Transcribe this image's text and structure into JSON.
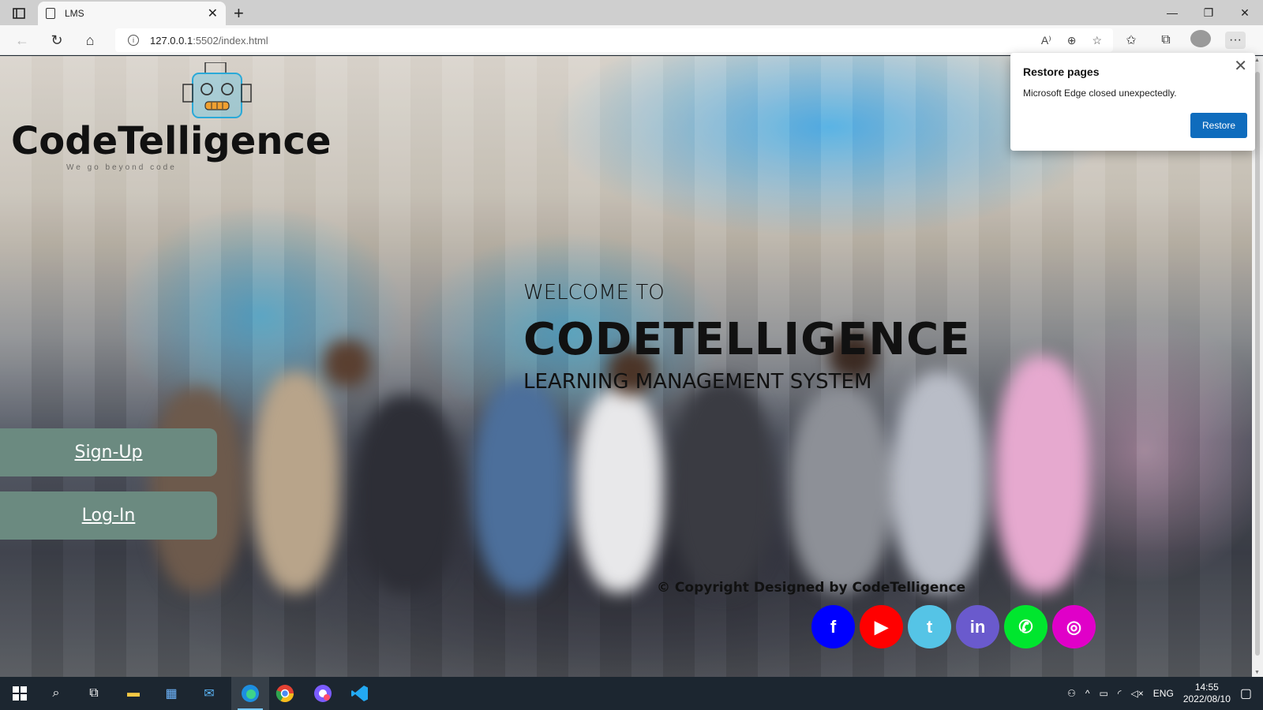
{
  "browser": {
    "tab_title": "LMS",
    "url_host": "127.0.0.1",
    "url_path": ":5502/index.html"
  },
  "page": {
    "logo_name": "CodeTelligence",
    "logo_tagline": "We go beyond code",
    "welcome_line1": "WELCOME TO",
    "welcome_line2": "CODETELLIGENCE",
    "welcome_line3": "LEARNING MANAGEMENT SYSTEM",
    "signup_label": "Sign-Up",
    "login_label": "Log-In",
    "copyright": "© Copyright Designed by CodeTelligence",
    "socials": [
      {
        "name": "facebook",
        "glyph": "f",
        "color": "#0000ff"
      },
      {
        "name": "youtube",
        "glyph": "▶",
        "color": "#ff0000"
      },
      {
        "name": "twitter",
        "glyph": "t",
        "color": "#55c4e6"
      },
      {
        "name": "linkedin",
        "glyph": "in",
        "color": "#6a5acd"
      },
      {
        "name": "whatsapp",
        "glyph": "✆",
        "color": "#00e62e"
      },
      {
        "name": "instagram",
        "glyph": "◎",
        "color": "#e000c8"
      }
    ]
  },
  "popup": {
    "title": "Restore pages",
    "message": "Microsoft Edge closed unexpectedly.",
    "button": "Restore"
  },
  "taskbar": {
    "language": "ENG",
    "time": "14:55",
    "date": "2022/08/10"
  }
}
